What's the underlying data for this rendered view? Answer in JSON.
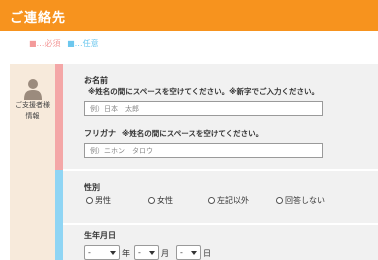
{
  "header": {
    "title": "ご連絡先"
  },
  "legend": {
    "required": "■…必須",
    "optional": "■…任意"
  },
  "section": {
    "label_line1": "ご支援者様",
    "label_line2": "情報"
  },
  "name": {
    "label": "お名前",
    "note": "※姓名の間にスペースを空けてください。※新字でご入力ください。",
    "placeholder": "例）日本　太郎"
  },
  "furigana": {
    "label": "フリガナ",
    "note": "※姓名の間にスペースを空けてください。",
    "placeholder": "例）ニホン　タロウ"
  },
  "gender": {
    "label": "性別",
    "options": [
      "男性",
      "女性",
      "左記以外",
      "回答しない"
    ]
  },
  "birthdate": {
    "label": "生年月日",
    "year_value": "-",
    "month_value": "-",
    "day_value": "-",
    "year_unit": "年",
    "month_unit": "月",
    "day_unit": "日"
  },
  "colors": {
    "header": "#f7931e",
    "required": "#f4a7a7",
    "optional": "#8fd5f4",
    "side": "#f7eadb"
  },
  "icons": {
    "avatar": "person-icon"
  }
}
